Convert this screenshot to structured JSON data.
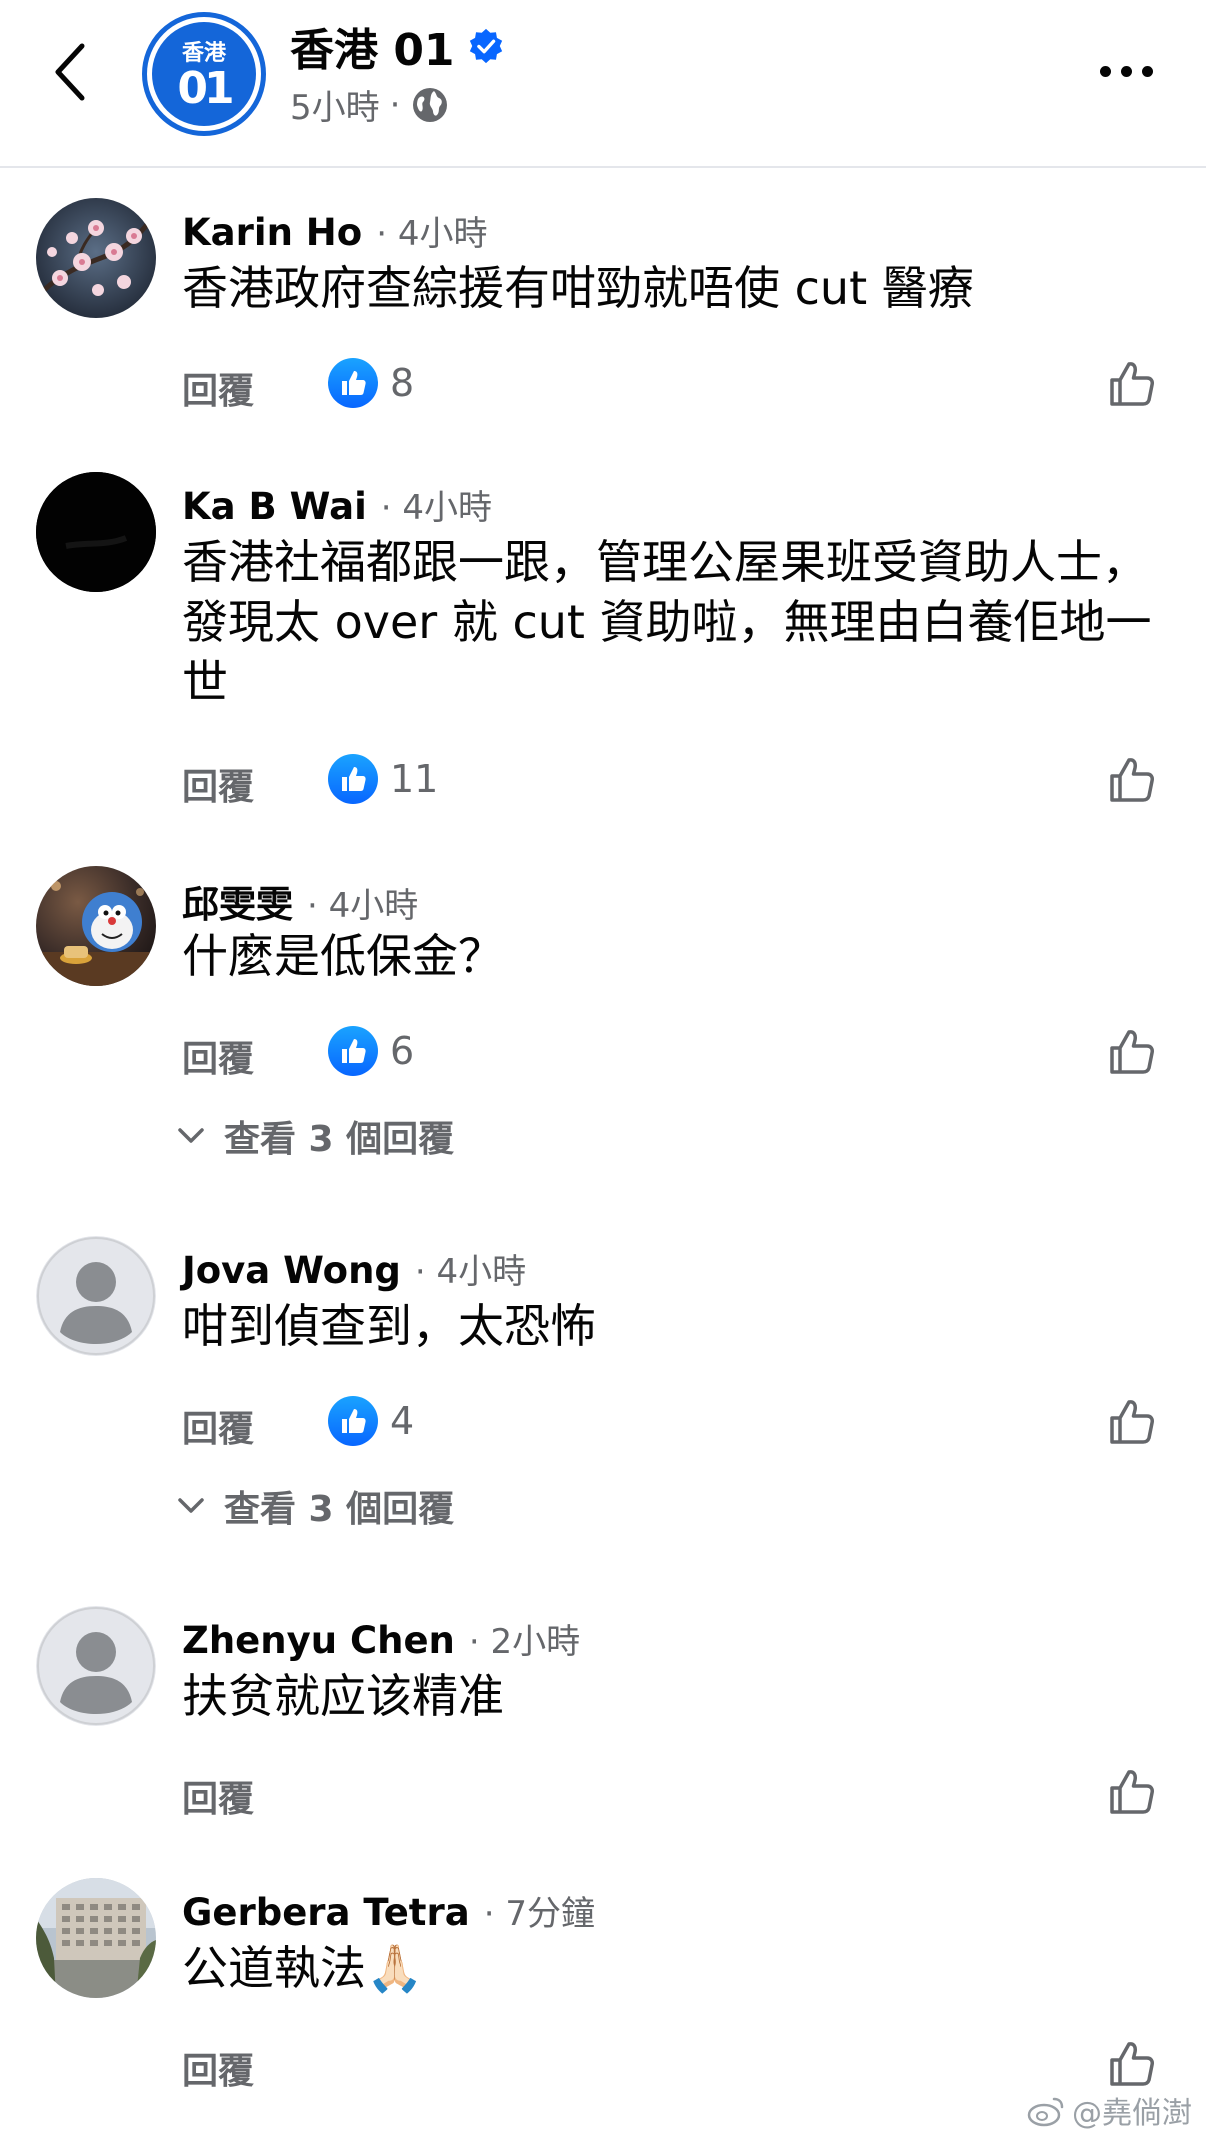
{
  "header": {
    "page_name": "香港 01",
    "logo_top": "香港",
    "logo_bottom": "01",
    "post_time": "5小時",
    "separator": "·"
  },
  "labels": {
    "reply": "回覆",
    "view_replies": "查看 3 個回覆",
    "separator": "·"
  },
  "comments": [
    {
      "author": "Karin Ho",
      "time": "4小時",
      "text": "香港政府查綜援有咁勁就唔使 cut 醫療",
      "reactions": "8",
      "avatar_icon": "plum-blossom-photo"
    },
    {
      "author": "Ka B Wai",
      "time": "4小時",
      "text": "香港社福都跟一跟，管理公屋果班受資助人士，發現太 over 就 cut 資助啦，無理由白養佢地一世",
      "reactions": "11",
      "avatar_icon": "black-photo"
    },
    {
      "author": "邱雯雯",
      "time": "4小時",
      "text": "什麼是低保金？",
      "reactions": "6",
      "avatar_icon": "cartoon-cat-photo",
      "view_replies": "查看 3 個回覆"
    },
    {
      "author": "Jova Wong",
      "time": "4小時",
      "text": "咁到偵查到，太恐怖",
      "reactions": "4",
      "avatar_icon": "default-user-icon",
      "view_replies": "查看 3 個回覆"
    },
    {
      "author": "Zhenyu Chen",
      "time": "2小時",
      "text": "扶贫就应该精准",
      "avatar_icon": "default-user-icon"
    },
    {
      "author": "Gerbera Tetra",
      "time": "7分鐘",
      "text": "公道執法🙏🏻",
      "avatar_icon": "building-photo"
    }
  ],
  "watermark": "@堯倘澍",
  "colors": {
    "brand_blue": "#1466d9",
    "reaction_blue": "#0866ff",
    "secondary_text": "#65676b",
    "primary_text": "#050505"
  }
}
